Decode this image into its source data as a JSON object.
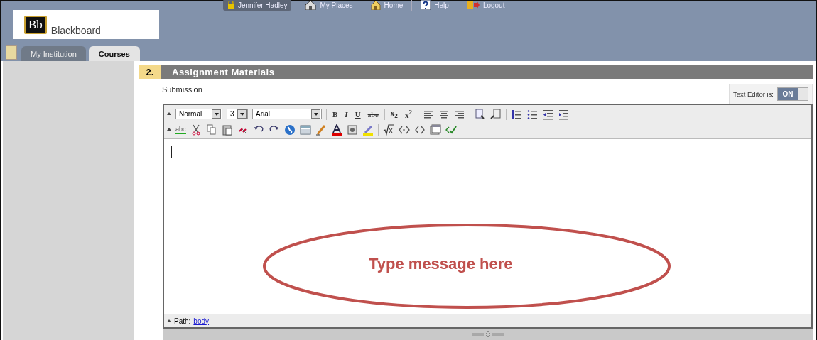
{
  "header": {
    "logo_mark": "Bb",
    "logo_text": "Blackboard",
    "nav": [
      {
        "label": "Jennifer Hadley",
        "selected": true
      },
      {
        "label": "My Places",
        "selected": false
      },
      {
        "label": "Home",
        "selected": false
      },
      {
        "label": "Help",
        "selected": false
      },
      {
        "label": "Logout",
        "selected": false
      }
    ]
  },
  "tabs": [
    {
      "label": "My Institution",
      "selected": false
    },
    {
      "label": "Courses",
      "selected": true
    }
  ],
  "section": {
    "number": "2.",
    "title": "Assignment Materials"
  },
  "field_label": "Submission",
  "text_editor": {
    "label": "Text Editor is:",
    "state_text": "ON",
    "on": true
  },
  "toolbar": {
    "format": "Normal",
    "size": "3",
    "font": "Arial",
    "text_buttons": [
      "B",
      "I",
      "U",
      "abe",
      "x$_{2}$",
      "x$^{2}$"
    ],
    "spell": "abc"
  },
  "path_label": "Path:",
  "path_link": "body",
  "annotation": "Type message here"
}
